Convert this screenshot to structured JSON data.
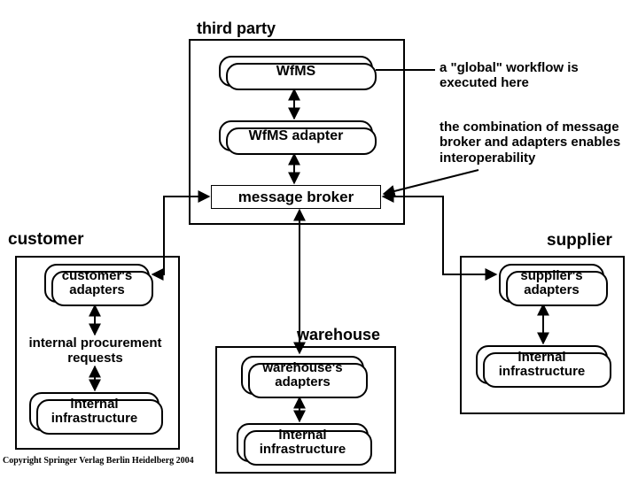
{
  "labels": {
    "third_party": "third party",
    "customer": "customer",
    "supplier": "supplier"
  },
  "nodes": {
    "wfms": "WfMS",
    "wfms_adapter": "WfMS adapter",
    "message_broker": "message broker",
    "customers_adapters": "customer's adapters",
    "suppliers_adapters": "supplier's adapters",
    "warehouses_adapters": "warehouse's adapters",
    "internal_infra_customer": "internal infrastructure",
    "internal_infra_warehouse": "internal infrastructure",
    "internal_infra_supplier": "internal infrastructure"
  },
  "text": {
    "warehouse": "warehouse",
    "internal_procurement": "internal procurement requests"
  },
  "annotations": {
    "global_wf": "a \"global\" workflow is executed here",
    "combo": "the combination of message broker and adapters enables interoperability"
  },
  "copyright": "Copyright Springer Verlag Berlin Heidelberg 2004"
}
